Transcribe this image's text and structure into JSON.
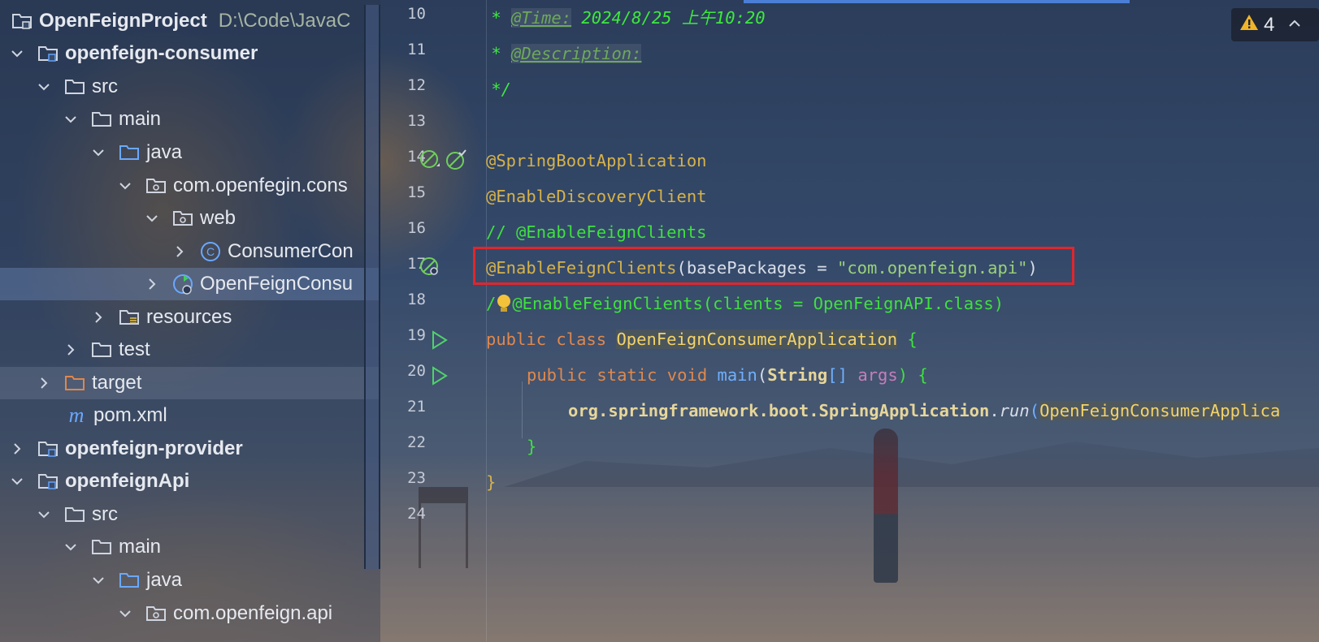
{
  "project": {
    "root_name": "OpenFeignProject",
    "root_path": "D:\\Code\\JavaC",
    "items": [
      {
        "label": "openfeign-consumer",
        "icon": "module-folder-icon",
        "bold": true
      },
      {
        "label": "src",
        "icon": "folder-icon"
      },
      {
        "label": "main",
        "icon": "folder-icon"
      },
      {
        "label": "java",
        "icon": "source-folder-icon"
      },
      {
        "label": "com.openfegin.cons",
        "icon": "package-icon"
      },
      {
        "label": "web",
        "icon": "package-icon"
      },
      {
        "label": "ConsumerCon",
        "icon": "class-icon"
      },
      {
        "label": "OpenFeignConsu",
        "icon": "spring-boot-class-icon"
      },
      {
        "label": "resources",
        "icon": "resources-folder-icon"
      },
      {
        "label": "test",
        "icon": "folder-icon"
      },
      {
        "label": "target",
        "icon": "excluded-folder-icon"
      },
      {
        "label": "pom.xml",
        "icon": "maven-icon"
      },
      {
        "label": "openfeign-provider",
        "icon": "module-folder-icon",
        "bold": true
      },
      {
        "label": "openfeignApi",
        "icon": "module-folder-icon",
        "bold": true
      },
      {
        "label": "src",
        "icon": "folder-icon"
      },
      {
        "label": "main",
        "icon": "folder-icon"
      },
      {
        "label": "java",
        "icon": "source-folder-icon"
      },
      {
        "label": "com.openfeign.api",
        "icon": "package-icon"
      }
    ]
  },
  "editor": {
    "line_numbers": [
      "10",
      "11",
      "12",
      "13",
      "14",
      "15",
      "16",
      "17",
      "18",
      "19",
      "20",
      "21",
      "22",
      "23",
      "24"
    ],
    "lines": {
      "l10_star": " * ",
      "l10_tag": "@Time:",
      "l10_text": " 2024/8/25 上午10:20",
      "l11_star": " * ",
      "l11_tag": "@Description:",
      "l12": " */",
      "l14": "@SpringBootApplication",
      "l15": "@EnableDiscoveryClient",
      "l16": "// @EnableFeignClients",
      "l17_ann": "@EnableFeignClients",
      "l17_open": "(",
      "l17_param": "basePackages = ",
      "l17_str": "\"com.openfeign.api\"",
      "l17_close": ")",
      "l18_a": "/",
      "l18_b": "@EnableFeignClients(clients = OpenFeignAPI.class)",
      "l19_kw": "public class ",
      "l19_cls": "OpenFeignConsumerApplication",
      "l19_br": " {",
      "l20_kw": "public static void ",
      "l20_fn": "main",
      "l20_p1": "(",
      "l20_type": "String",
      "l20_arr": "[] ",
      "l20_arg": "args",
      "l20_p2": ") {",
      "l21_pkg": "org.springframework.boot.SpringApplication",
      "l21_dot": ".",
      "l21_run": "run",
      "l21_paren": "(",
      "l21_cls": "OpenFeignConsumerApplica",
      "l22": "}",
      "l23": "}"
    }
  },
  "warnings": {
    "count": "4"
  },
  "colors": {
    "highlight_box": "#e0262c",
    "comment_green": "#3ee83e",
    "annotation_yellow": "#d6b24a"
  }
}
